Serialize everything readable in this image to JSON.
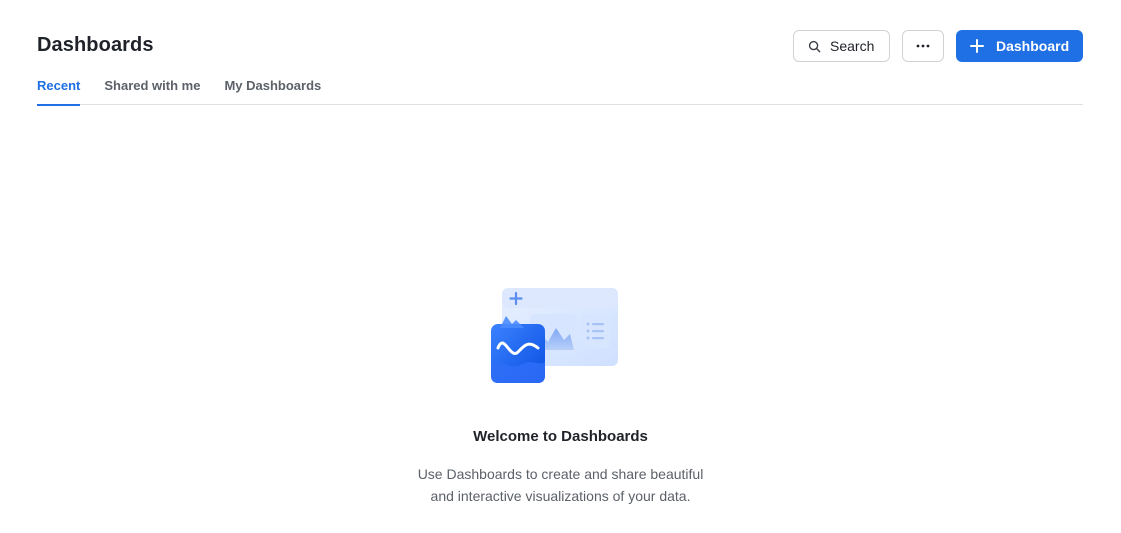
{
  "header": {
    "title": "Dashboards",
    "search_label": "Search",
    "more_label": "···",
    "new_label": "Dashboard",
    "icons": {
      "search": "search-icon",
      "more": "more-horizontal-icon",
      "add": "plus-icon"
    }
  },
  "tabs": [
    {
      "label": "Recent",
      "active": true
    },
    {
      "label": "Shared with me",
      "active": false
    },
    {
      "label": "My Dashboards",
      "active": false
    }
  ],
  "empty_state": {
    "illustration": "dashboard-illustration",
    "title": "Welcome to Dashboards",
    "description": "Use Dashboards to create and share beautiful and interactive visualizations of your data."
  },
  "colors": {
    "accent": "#1f6fe5",
    "text": "#1f2329",
    "muted": "#5c6169",
    "border": "#dee0e3"
  }
}
